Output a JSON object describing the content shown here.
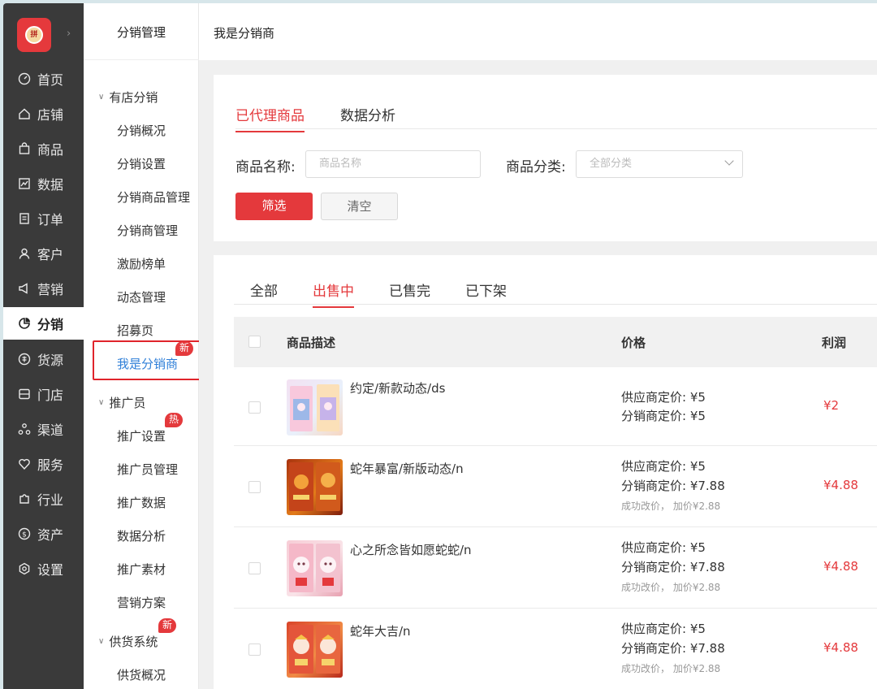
{
  "logo_text": "拼",
  "rail": {
    "items": [
      {
        "label": "首页",
        "icon": "dashboard-icon"
      },
      {
        "label": "店铺",
        "icon": "home-icon"
      },
      {
        "label": "商品",
        "icon": "bag-icon"
      },
      {
        "label": "数据",
        "icon": "chart-icon"
      },
      {
        "label": "订单",
        "icon": "document-icon"
      },
      {
        "label": "客户",
        "icon": "user-icon"
      },
      {
        "label": "营销",
        "icon": "megaphone-icon"
      },
      {
        "label": "分销",
        "icon": "pie-icon"
      },
      {
        "label": "货源",
        "icon": "source-icon"
      },
      {
        "label": "门店",
        "icon": "store-icon"
      },
      {
        "label": "渠道",
        "icon": "channel-icon"
      },
      {
        "label": "服务",
        "icon": "heart-icon"
      },
      {
        "label": "行业",
        "icon": "puzzle-icon"
      },
      {
        "label": "资产",
        "icon": "dollar-icon"
      },
      {
        "label": "设置",
        "icon": "settings-icon"
      }
    ],
    "active_index": 7
  },
  "submenu": {
    "title": "分销管理",
    "groups": [
      {
        "label": "有店分销",
        "items": [
          "分销概况",
          "分销设置",
          "分销商品管理",
          "分销商管理",
          "激励榜单",
          "动态管理",
          "招募页",
          "我是分销商"
        ]
      },
      {
        "label": "推广员",
        "items": [
          "推广设置",
          "推广员管理",
          "推广数据",
          "数据分析",
          "推广素材",
          "营销方案"
        ]
      },
      {
        "label": "供货系统",
        "items": [
          "供货概况"
        ]
      }
    ],
    "badges": {
      "new": "新",
      "hot": "热"
    },
    "active_item": "我是分销商"
  },
  "header": {
    "breadcrumb": "我是分销商"
  },
  "filter": {
    "tabs": [
      "已代理商品",
      "数据分析"
    ],
    "active_tab": 0,
    "name_label": "商品名称:",
    "name_placeholder": "商品名称",
    "category_label": "商品分类:",
    "category_value": "全部分类",
    "filter_button": "筛选",
    "clear_button": "清空"
  },
  "list": {
    "status_tabs": [
      "全部",
      "出售中",
      "已售完",
      "已下架"
    ],
    "active_status": 1,
    "columns": {
      "desc": "商品描述",
      "price": "价格",
      "profit": "利润"
    },
    "rows": [
      {
        "name": "约定/新款动态/ds",
        "supplier_price": "供应商定价: ¥5",
        "distributor_price": "分销商定价: ¥5",
        "note": "",
        "profit": "¥2"
      },
      {
        "name": "蛇年暴富/新版动态/n",
        "supplier_price": "供应商定价: ¥5",
        "distributor_price": "分销商定价: ¥7.88",
        "note": "成功改价，   加价¥2.88",
        "profit": "¥4.88"
      },
      {
        "name": "心之所念皆如愿蛇蛇/n",
        "supplier_price": "供应商定价: ¥5",
        "distributor_price": "分销商定价: ¥7.88",
        "note": "成功改价，   加价¥2.88",
        "profit": "¥4.88"
      },
      {
        "name": "蛇年大吉/n",
        "supplier_price": "供应商定价: ¥5",
        "distributor_price": "分销商定价: ¥7.88",
        "note": "成功改价，   加价¥2.88",
        "profit": "¥4.88"
      }
    ]
  }
}
